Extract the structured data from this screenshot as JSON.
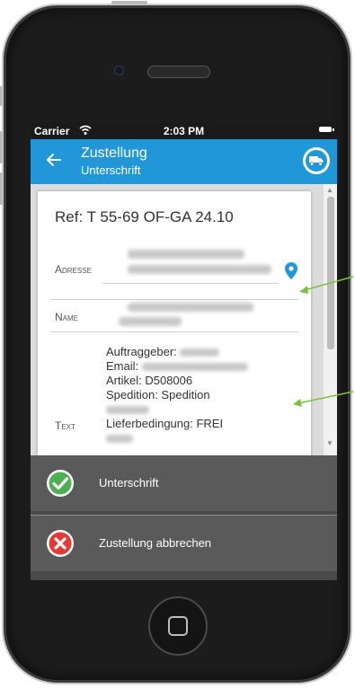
{
  "status_bar": {
    "carrier": "Carrier",
    "time": "2:03 PM"
  },
  "app_bar": {
    "title": "Zustellung",
    "subtitle": "Unterschrift",
    "back_icon": "arrow-left-icon",
    "truck_icon": "truck-icon",
    "accent_color": "#2196d8"
  },
  "card": {
    "reference": "Ref: T 55-69 OF-GA 24.10",
    "fields": {
      "address_label": "Adresse",
      "name_label": "Name",
      "text_label": "Text"
    },
    "text_lines": {
      "auftraggeber": "Auftraggeber:",
      "email": "Email:",
      "artikel": "Artikel: D508006",
      "spedition": "Spedition: Spedition",
      "lieferbedingung": "Lieferbedingung: FREI"
    },
    "location_icon": "map-pin-icon"
  },
  "actions": [
    {
      "label": "Unterschrift",
      "icon": "check-circle-icon",
      "color": "#4caf50"
    },
    {
      "label": "Zustellung abbrechen",
      "icon": "cancel-circle-icon",
      "color": "#e53935"
    }
  ]
}
